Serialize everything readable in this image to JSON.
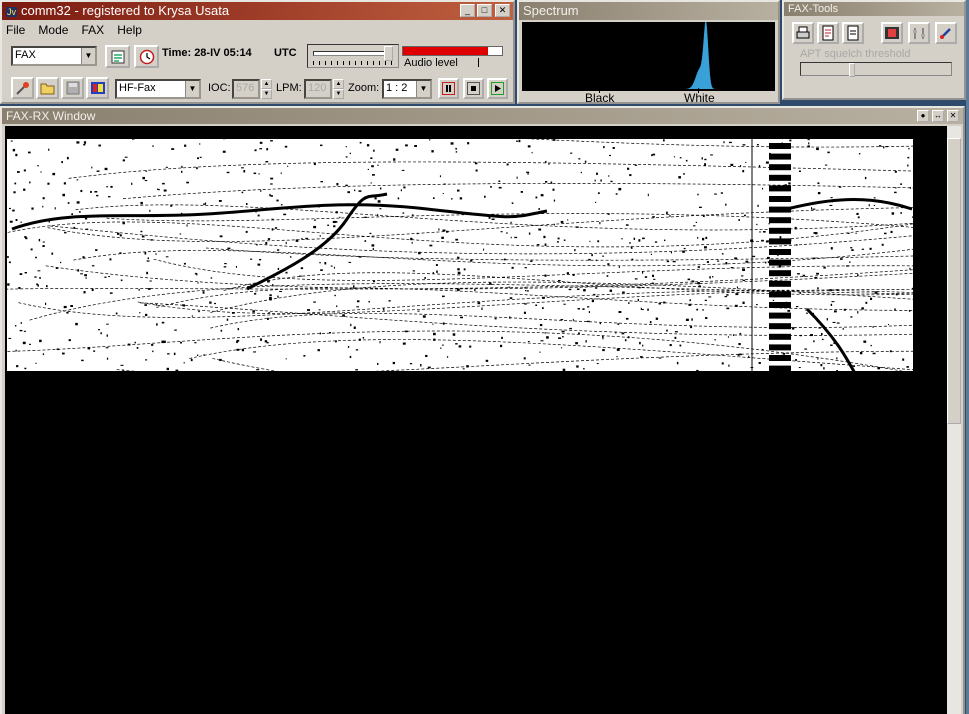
{
  "main_window": {
    "title": "comm32 - registered to Krysa Usata",
    "app_icon": "Jv",
    "menu": [
      "File",
      "Mode",
      "FAX",
      "Help"
    ],
    "mode_select": "FAX",
    "time_label": "Time: 28-IV 05:14",
    "timezone": "UTC",
    "audio_level_label": "Audio level",
    "audio_level_fraction": 0.86,
    "profile_select": "HF-Fax",
    "ioc_label": "IOC:",
    "ioc_value": "576",
    "lpm_label": "LPM:",
    "lpm_value": "120",
    "zoom_label": "Zoom:",
    "zoom_value": "1 : 2"
  },
  "spectrum": {
    "title": "Spectrum",
    "left_label": "Black",
    "right_label": "White"
  },
  "fax_tools": {
    "title": "FAX-Tools",
    "squelch_label": "APT squelch threshold"
  },
  "fax_rx": {
    "title": "FAX-RX Window"
  },
  "colors": {
    "title_active": "#7a1a10",
    "audio_bar": "#e00000",
    "spectrum_peak": "#3aa0d8",
    "window_face": "#d4d0c8"
  }
}
